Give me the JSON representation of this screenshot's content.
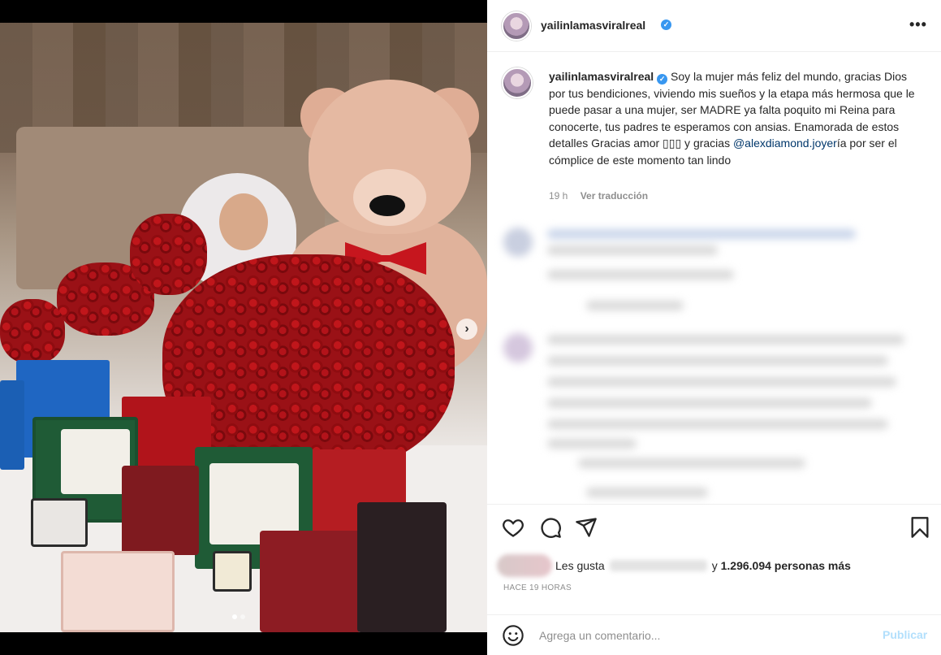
{
  "post": {
    "username": "yailinlamasviralreal",
    "verified_mark": "✓",
    "caption_text_1": " Soy la mujer más feliz del mundo, gracias Dios por tus bendiciones, viviendo mis sueños y la etapa más hermosa que le puede pasar a una mujer, ser MADRE ya falta poquito mi Reina para conocerte, tus padres te esperamos con ansias. Enamorada de estos detalles Gracias amor ▯▯▯ y gracias ",
    "mention": "@alexdiamond.joyer",
    "caption_text_2": "ía por ser el cómplice de este momento tan lindo",
    "time": "19 h",
    "translate_label": "Ver traducción"
  },
  "likes": {
    "prefix": "Les gusta",
    "connector": "y",
    "count_text": "1.296.094 personas más"
  },
  "time_ago": "HACE 19 HORAS",
  "comment": {
    "placeholder": "Agrega un comentario...",
    "publish_label": "Publicar"
  },
  "icons": {
    "more": "more-options-icon",
    "next": "chevron-right-icon",
    "like": "heart-icon",
    "comment": "comment-icon",
    "share": "paper-plane-icon",
    "save": "bookmark-icon",
    "emoji": "emoji-icon"
  },
  "colors": {
    "link": "#00376b",
    "verified": "#3897f0",
    "publish_disabled": "#b2dffc",
    "muted": "#8e8e8e"
  },
  "carousel": {
    "slide_index": 1,
    "slide_count": 2
  }
}
